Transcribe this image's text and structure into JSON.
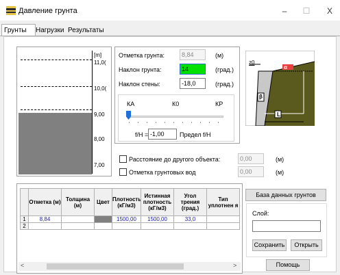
{
  "window": {
    "title": "Давление грунта",
    "minimize": "–",
    "maximize": "☐",
    "close": "X"
  },
  "tabs": [
    "Грунты",
    "Нагрузки",
    "Результаты"
  ],
  "profile": {
    "unit": "[m]",
    "ticks": [
      "11,0(",
      "10,0(",
      "9,00",
      "8,00",
      "7,00"
    ]
  },
  "params": {
    "ground_mark_label": "Отметка грунта:",
    "ground_mark_value": "8,84",
    "ground_mark_unit": "(м)",
    "ground_slope_label": "Наклон грунта:",
    "ground_slope_value": "14",
    "ground_slope_unit": "(град.)",
    "wall_slope_label": "Наклон стены:",
    "wall_slope_value": "-18,0",
    "wall_slope_unit": "(град.)"
  },
  "slider": {
    "left_label": "КА",
    "mid_label": "К0",
    "right_label": "КР",
    "fh_label": "f/H =",
    "fh_value": "-1,00",
    "limit_label": "Предел f/H"
  },
  "diagram": {
    "z_label": "z0",
    "alpha_label": "α",
    "beta_label": "β",
    "l_label": "L"
  },
  "options": {
    "distance_label": "Расстояние до другого объекта:",
    "distance_value": "0,00",
    "distance_unit": "(м)",
    "water_label": "Отметка грунтовых вод",
    "water_value": "0,00",
    "water_unit": "(м)"
  },
  "table": {
    "headers": [
      "Отметка (м)",
      "Толщина (м)",
      "Цвет",
      "Плотность (кГ/м3)",
      "Истинная плотность (кГ/м3)",
      "Угол трения (град.)",
      "Тип уплотнен я"
    ],
    "rows": [
      {
        "num": "1",
        "mark": "8,84",
        "thick": "",
        "density": "1500,00",
        "true_density": "1500,00",
        "angle": "33,0",
        "type": ""
      },
      {
        "num": "2",
        "mark": "",
        "thick": "",
        "density": "",
        "true_density": "",
        "angle": "",
        "type": ""
      }
    ]
  },
  "side": {
    "db_button": "База данных грунтов",
    "layer_label": "Слой:",
    "layer_value": "",
    "save_button": "Сохранить",
    "open_button": "Открыть",
    "help_button": "Помощь"
  },
  "colors": {
    "soil_fill": "#808080",
    "diagram_bg": "#5a5a1e",
    "slope_input_bg": "#00e000",
    "slider_thumb": "#1e6fd9"
  }
}
